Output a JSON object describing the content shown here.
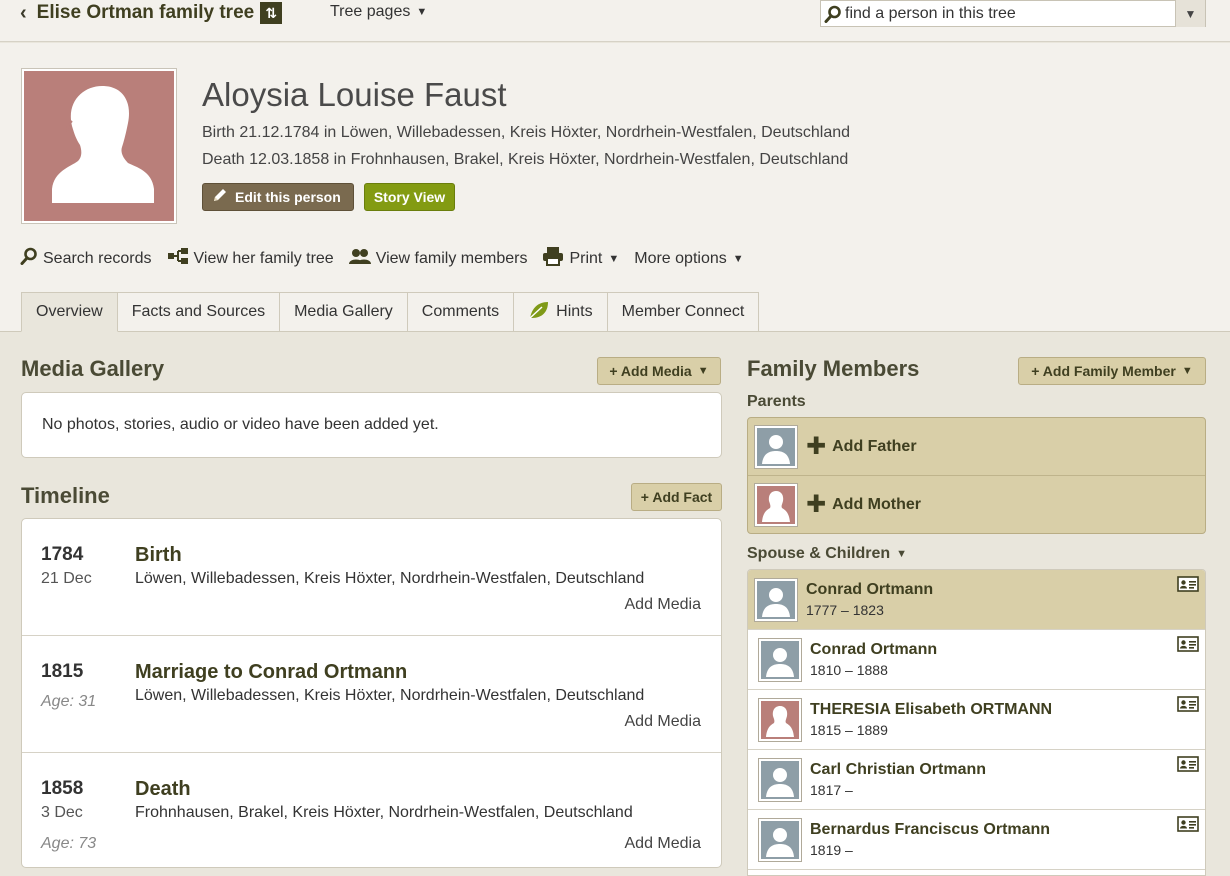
{
  "topbar": {
    "tree_title": "Elise Ortman family tree",
    "tree_pages_label": "Tree pages",
    "search_value": "find a person in this tree"
  },
  "person": {
    "name": "Aloysia Louise Faust",
    "birth_line": "Birth 21.12.1784 in Löwen, Willebadessen, Kreis Höxter, Nordrhein-Westfalen, Deutschland",
    "death_line": "Death 12.03.1858 in Frohnhausen, Brakel, Kreis Höxter, Nordrhein-Westfalen, Deutschland",
    "edit_label": "Edit this person",
    "story_label": "Story View"
  },
  "actions": {
    "search_records": "Search records",
    "view_family_tree": "View her family tree",
    "view_family_members": "View family members",
    "print": "Print",
    "more_options": "More options"
  },
  "tabs": [
    "Overview",
    "Facts and Sources",
    "Media Gallery",
    "Comments",
    "Hints",
    "Member Connect"
  ],
  "media_gallery": {
    "title": "Media Gallery",
    "add_label": "+ Add Media",
    "empty_text": "No photos, stories, audio or video have been added yet."
  },
  "timeline": {
    "title": "Timeline",
    "add_label": "+ Add Fact",
    "add_media_label": "Add Media",
    "events": [
      {
        "year": "1784",
        "sub": "21 Dec",
        "age": "",
        "title": "Birth",
        "place": "Löwen, Willebadessen, Kreis Höxter, Nordrhein-Westfalen, Deutschland"
      },
      {
        "year": "1815",
        "sub": "",
        "age": "Age: 31",
        "title": "Marriage to Conrad Ortmann",
        "place": "Löwen, Willebadessen, Kreis Höxter, Nordrhein-Westfalen, Deutschland"
      },
      {
        "year": "1858",
        "sub": "3 Dec",
        "age": "Age: 73",
        "title": "Death",
        "place": "Frohnhausen, Brakel, Kreis Höxter, Nordrhein-Westfalen, Deutschland"
      }
    ]
  },
  "family": {
    "title": "Family Members",
    "add_label": "+ Add Family Member",
    "parents_label": "Parents",
    "add_father": "Add Father",
    "add_mother": "Add Mother",
    "spouse_label": "Spouse & Children",
    "spouse": {
      "name": "Conrad Ortmann",
      "years": "1777 – 1823",
      "gender": "male"
    },
    "children": [
      {
        "name": "Conrad Ortmann",
        "years": "1810 – 1888",
        "gender": "male"
      },
      {
        "name": "THERESIA Elisabeth ORTMANN",
        "years": "1815 – 1889",
        "gender": "female"
      },
      {
        "name": "Carl Christian Ortmann",
        "years": "1817 –",
        "gender": "male"
      },
      {
        "name": "Bernardus Franciscus Ortmann",
        "years": "1819 –",
        "gender": "male"
      }
    ]
  },
  "colors": {
    "accent_olive": "#839b12",
    "edit_brown": "#7a6a4f",
    "panel_tan": "#d9cfa8",
    "female_silhouette": "#b97f7a",
    "male_silhouette": "#8e9ea7"
  },
  "icons": [
    "chevron-left-icon",
    "tree-switch-icon",
    "caret-down-icon",
    "search-icon",
    "pencil-icon",
    "family-tree-icon",
    "family-members-icon",
    "print-icon",
    "leaf-icon",
    "plus-icon",
    "person-card-icon"
  ]
}
